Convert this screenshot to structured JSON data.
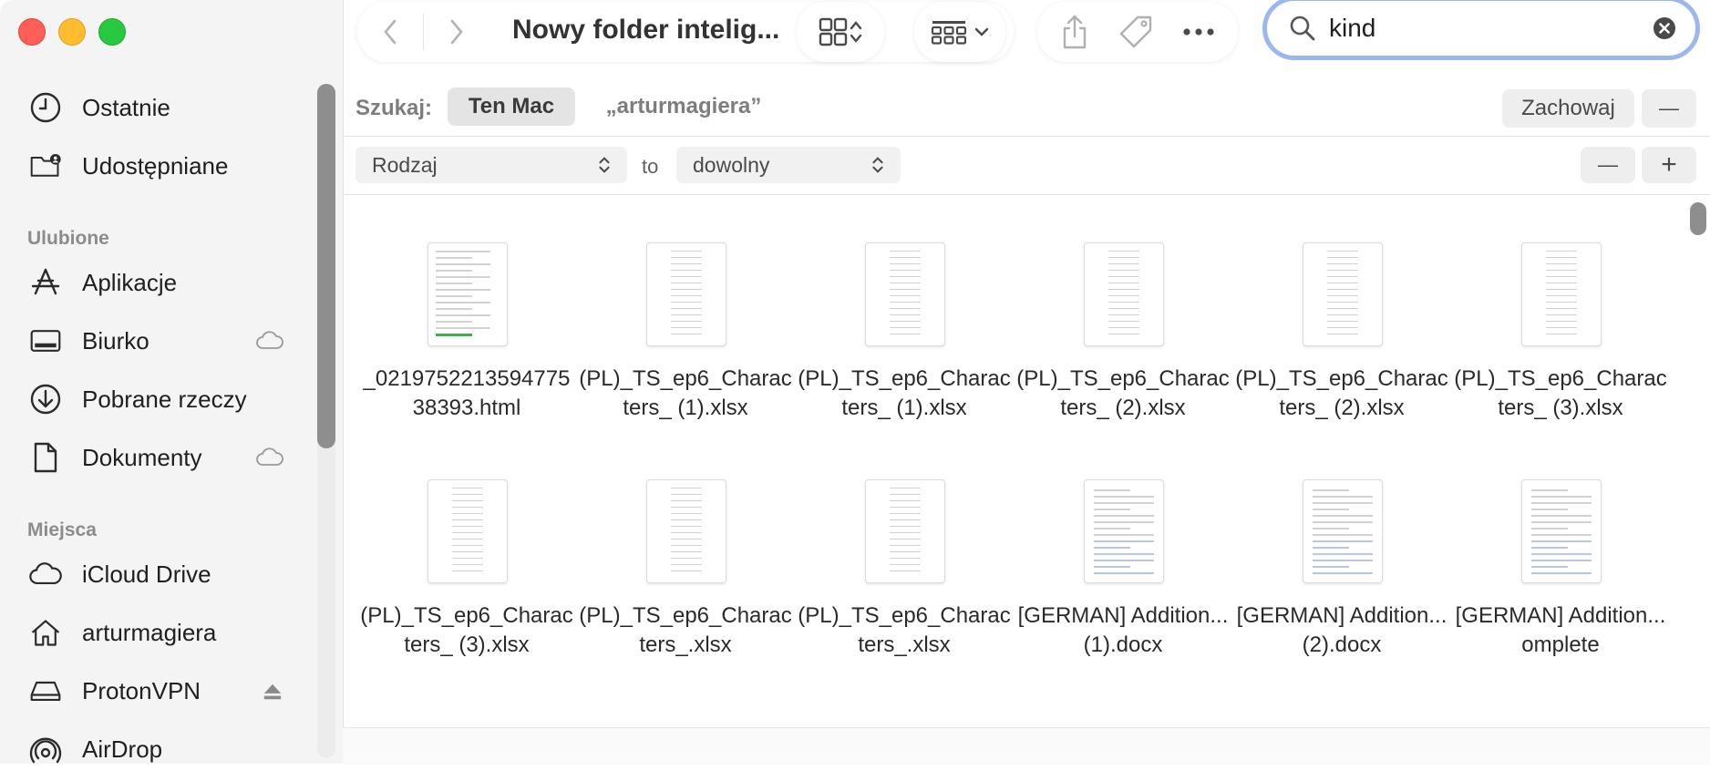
{
  "window": {
    "title": "Nowy folder intelig..."
  },
  "sidebar": {
    "items_top": [
      {
        "label": "Ostatnie",
        "icon": "clock-icon"
      },
      {
        "label": "Udostępniane",
        "icon": "shared-folder-icon"
      }
    ],
    "favorites_header": "Ulubione",
    "favorites": [
      {
        "label": "Aplikacje",
        "icon": "applications-icon"
      },
      {
        "label": "Biurko",
        "icon": "desktop-icon"
      },
      {
        "label": "Pobrane rzeczy",
        "icon": "downloads-icon"
      },
      {
        "label": "Dokumenty",
        "icon": "document-icon"
      }
    ],
    "locations_header": "Miejsca",
    "locations": [
      {
        "label": "iCloud Drive",
        "icon": "icloud-icon"
      },
      {
        "label": "arturmagiera",
        "icon": "home-icon"
      },
      {
        "label": "ProtonVPN",
        "icon": "drive-icon"
      },
      {
        "label": "AirDrop",
        "icon": "airdrop-icon"
      }
    ]
  },
  "search": {
    "value": "kind"
  },
  "scope": {
    "label": "Szukaj:",
    "this_mac": "Ten Mac",
    "user": "„arturmagiera”",
    "save": "Zachowaj",
    "remove": "—"
  },
  "criteria": {
    "attribute": "Rodzaj",
    "connector": "to",
    "value": "dowolny",
    "minus": "—",
    "plus": "+"
  },
  "files": [
    {
      "name": "_021975221359477538393.html",
      "thumb": "doc"
    },
    {
      "name": "(PL)_TS_ep6_Characters_ (1).xlsx",
      "thumb": "sheet"
    },
    {
      "name": "(PL)_TS_ep6_Characters_ (1).xlsx",
      "thumb": "sheet"
    },
    {
      "name": "(PL)_TS_ep6_Characters_ (2).xlsx",
      "thumb": "sheet"
    },
    {
      "name": "(PL)_TS_ep6_Characters_ (2).xlsx",
      "thumb": "sheet"
    },
    {
      "name": "(PL)_TS_ep6_Characters_ (3).xlsx",
      "thumb": "sheet"
    },
    {
      "name": "(PL)_TS_ep6_Characters_ (3).xlsx",
      "thumb": "sheet"
    },
    {
      "name": "(PL)_TS_ep6_Characters_.xlsx",
      "thumb": "sheet"
    },
    {
      "name": "(PL)_TS_ep6_Characters_.xlsx",
      "thumb": "sheet"
    },
    {
      "name": "[GERMAN] Addition...(1).docx",
      "thumb": "table"
    },
    {
      "name": "[GERMAN] Addition...(2).docx",
      "thumb": "table"
    },
    {
      "name": "[GERMAN] Addition...omplete",
      "thumb": "table"
    }
  ],
  "colors": {
    "accent_focus": "#9bb7ee",
    "close": "#fe5f57",
    "minimize": "#febc2e",
    "maximize": "#28c840"
  }
}
